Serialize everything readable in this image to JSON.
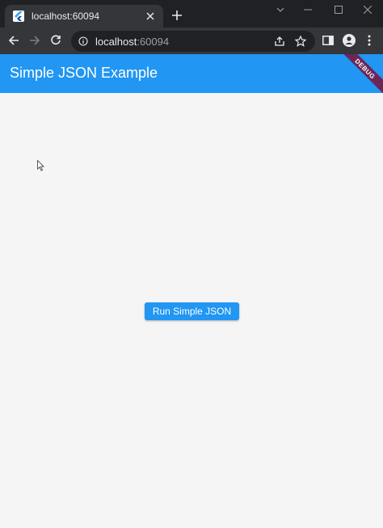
{
  "browser": {
    "tab": {
      "title": "localhost:60094",
      "favicon": "flutter-icon"
    },
    "new_tab": "plus-icon",
    "window_controls": [
      "chevron-down-icon",
      "minimize-icon",
      "maximize-icon",
      "close-icon"
    ],
    "address": {
      "host": "localhost",
      "port": ":60094"
    },
    "nav_icons": [
      "back-arrow-icon",
      "forward-arrow-icon",
      "reload-icon"
    ],
    "toolbar_icons": [
      "share-icon",
      "star-icon",
      "side-panel-icon",
      "profile-icon",
      "menu-icon"
    ]
  },
  "app": {
    "title": "Simple JSON Example",
    "debug_banner": "DEBUG",
    "button_label": "Run Simple JSON",
    "colors": {
      "primary": "#2196f3",
      "background": "#f5f5f5",
      "banner": "#78143c"
    }
  }
}
